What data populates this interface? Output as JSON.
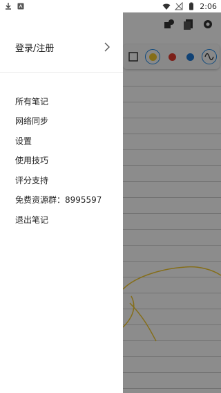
{
  "statusbar": {
    "time": "2:06",
    "icons": [
      "download-icon",
      "app-notification-icon",
      "wifi-icon",
      "no-signal-icon",
      "battery-icon"
    ]
  },
  "drawer": {
    "login_label": "登录/注册",
    "menu_items": [
      {
        "label": "所有笔记"
      },
      {
        "label": "网络同步"
      },
      {
        "label": "设置"
      },
      {
        "label": "使用技巧"
      },
      {
        "label": "评分支持"
      },
      {
        "label": "免费资源群：8995597"
      },
      {
        "label": "退出笔记"
      }
    ]
  },
  "app": {
    "palette_colors": [
      "#f2c82f",
      "#e23b2e",
      "#1e78d6"
    ]
  },
  "colors": {
    "scrim": "#000000",
    "accent": "#1e88e5"
  }
}
